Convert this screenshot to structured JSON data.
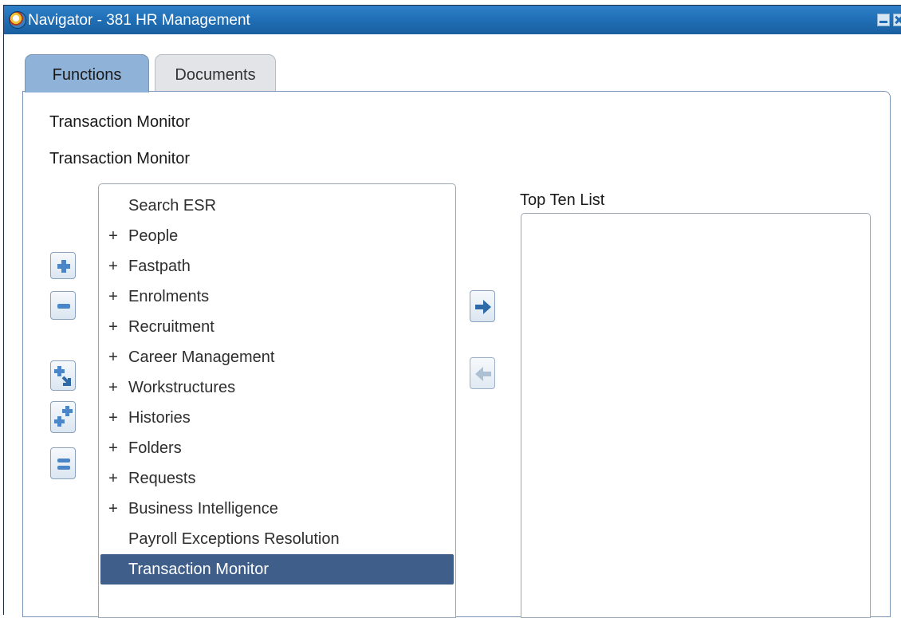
{
  "window": {
    "title": "Navigator - 381 HR Management"
  },
  "tabs": [
    {
      "label": "Functions",
      "active": true
    },
    {
      "label": "Documents",
      "active": false
    }
  ],
  "labels": {
    "selection_1": "Transaction Monitor",
    "selection_2": "Transaction Monitor",
    "top_ten": "Top Ten List"
  },
  "tree": {
    "items": [
      {
        "expander": "",
        "label": "Search ESR"
      },
      {
        "expander": "+",
        "label": "People"
      },
      {
        "expander": "+",
        "label": "Fastpath"
      },
      {
        "expander": "+",
        "label": "Enrolments"
      },
      {
        "expander": "+",
        "label": "Recruitment"
      },
      {
        "expander": "+",
        "label": "Career Management"
      },
      {
        "expander": "+",
        "label": "Workstructures"
      },
      {
        "expander": "+",
        "label": "Histories"
      },
      {
        "expander": "+",
        "label": "Folders"
      },
      {
        "expander": "+",
        "label": "Requests"
      },
      {
        "expander": "+",
        "label": "Business Intelligence"
      },
      {
        "expander": "",
        "label": "Payroll Exceptions Resolution"
      },
      {
        "expander": "",
        "label": "Transaction Monitor",
        "selected": true
      }
    ]
  },
  "icons": {
    "expand": "plus-icon",
    "collapse": "minus-icon",
    "expand_branch": "expand-branch-icon",
    "expand_all": "expand-all-icon",
    "collapse_all": "collapse-all-icon",
    "add_to_list": "arrow-right-icon",
    "remove_from_list": "arrow-left-icon",
    "minimize": "minimize-icon",
    "close": "close-icon"
  },
  "colors": {
    "titlebar": "#1f6db4",
    "active_tab": "#8fb3d8",
    "selected_row": "#3f5f8a",
    "button_icon": "#4a86c8"
  }
}
